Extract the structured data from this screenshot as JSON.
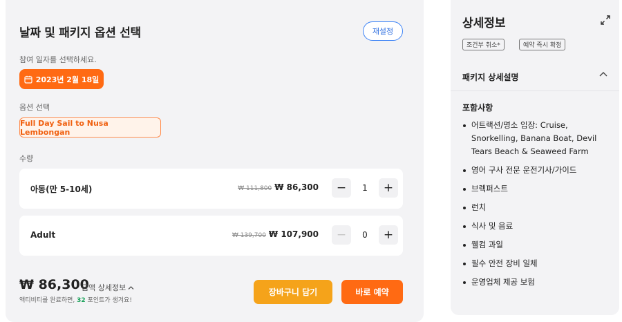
{
  "booking": {
    "title": "날짜 및 패키지 옵션 선택",
    "reset_label": "재설정",
    "date_label": "참여 일자를 선택하세요.",
    "selected_date": "2023년 2월 18일",
    "option_label": "옵션 선택",
    "selected_option": "Full Day Sail to Nusa Lembongan",
    "quantity_label": "수량",
    "rows": [
      {
        "name": "아동(만 5-10세)",
        "old_price": "₩ 111,800",
        "price": "₩ 86,300",
        "qty": "1",
        "minus_enabled": true
      },
      {
        "name": "Adult",
        "old_price": "₩ 139,700",
        "price": "₩ 107,900",
        "qty": "0",
        "minus_enabled": false
      }
    ],
    "total_price": "₩ 86,300",
    "total_detail_label": "금액 상세정보",
    "points_prefix": "액티비티를 완료하면, ",
    "points_value": "32",
    "points_suffix": " 포인트가 생겨요!",
    "cart_label": "장바구니 담기",
    "book_label": "바로 예약"
  },
  "details": {
    "title": "상세정보",
    "tags": [
      "조건부 취소*",
      "예약 즉시 확정"
    ],
    "section_title": "패키지 상세설명",
    "included_title": "포함사항",
    "included": [
      "어트랙션/명소 입장: Cruise, Snorkelling, Banana Boat, Devil Tears Beach & Seaweed Farm",
      "영어 구사 전문 운전기사/가이드",
      "브렉퍼스트",
      "런치",
      "식사 및 음료",
      "웰컴 과일",
      "필수 안전 장비 일체",
      "운영업체 제공 보험"
    ]
  },
  "icons": {
    "date": "calendar-icon",
    "total_detail": "chevron-up-icon",
    "expand": "expand-icon",
    "section_toggle": "chevron-up-icon"
  },
  "colors": {
    "primary_orange": "#ff6a13",
    "cart_yellow": "#f5a31a",
    "reset_blue": "#2f6fe0",
    "points_green": "#18a058",
    "panel_bg": "#f3f3f5"
  }
}
